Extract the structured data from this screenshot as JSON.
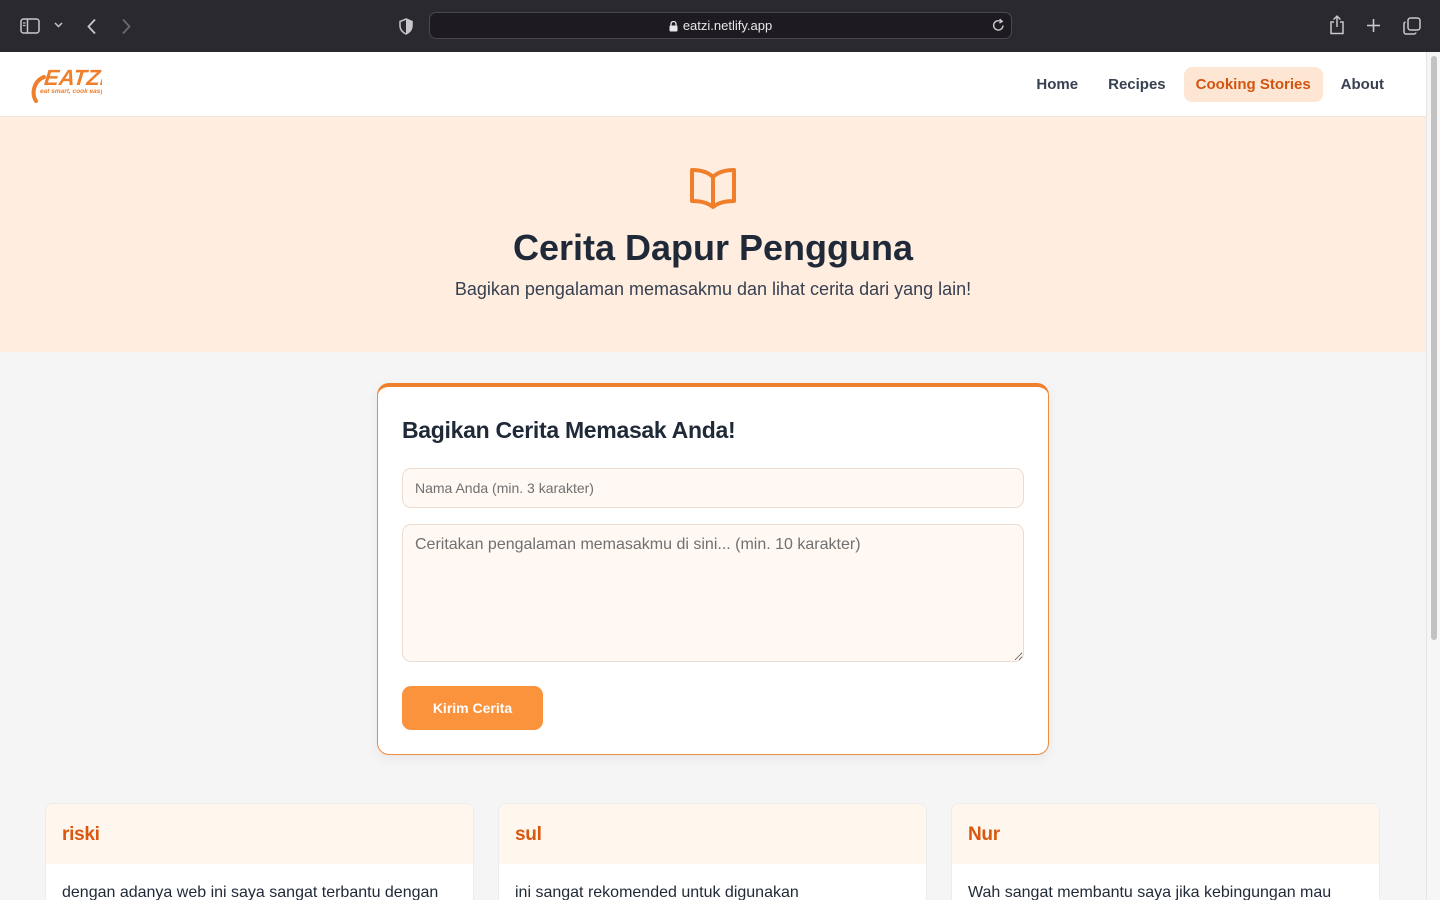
{
  "browser": {
    "url": "eatzi.netlify.app"
  },
  "brand": {
    "name": "EATZI",
    "tagline": "eat smart, cook easy",
    "accent_color": "#f07f2b"
  },
  "nav": {
    "items": [
      {
        "label": "Home",
        "active": false
      },
      {
        "label": "Recipes",
        "active": false
      },
      {
        "label": "Cooking Stories",
        "active": true
      },
      {
        "label": "About",
        "active": false
      }
    ]
  },
  "hero": {
    "icon": "open-book-icon",
    "title": "Cerita Dapur Pengguna",
    "subtitle": "Bagikan pengalaman memasakmu dan lihat cerita dari yang lain!"
  },
  "form": {
    "title": "Bagikan Cerita Memasak Anda!",
    "name_placeholder": "Nama Anda (min. 3 karakter)",
    "name_value": "",
    "story_placeholder": "Ceritakan pengalaman memasakmu di sini... (min. 10 karakter)",
    "story_value": "",
    "submit_label": "Kirim Cerita"
  },
  "stories": [
    {
      "author": "riski",
      "text": "dengan adanya web ini saya sangat terbantu dengan"
    },
    {
      "author": "sul",
      "text": "ini sangat rekomended untuk digunakan"
    },
    {
      "author": "Nur",
      "text": "Wah sangat membantu saya jika kebingungan mau"
    }
  ]
}
